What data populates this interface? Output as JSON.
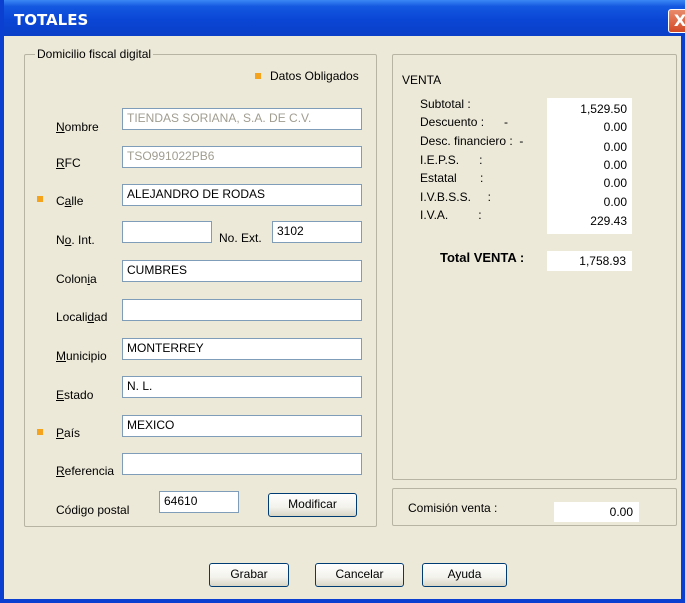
{
  "window": {
    "title": "TOTALES",
    "close_glyph": "X"
  },
  "fiscal": {
    "legend": "Domicilio fiscal digital",
    "required_note": "Datos Obligados",
    "nombre": {
      "label_pre": "",
      "label_u": "N",
      "label_post": "ombre",
      "value": "TIENDAS SORIANA, S.A. DE C.V."
    },
    "rfc": {
      "label_u": "R",
      "label_post": "FC",
      "value": "TSO991022PB6"
    },
    "calle": {
      "label_pre": "C",
      "label_u": "a",
      "label_post": "lle",
      "value": "ALEJANDRO DE RODAS"
    },
    "no_int": {
      "label_pre": "N",
      "label_u": "o",
      "label_post": ". Int.",
      "value": ""
    },
    "no_ext": {
      "label": "No. Ext.",
      "value": "3102"
    },
    "colonia": {
      "label_pre": "Colon",
      "label_u": "i",
      "label_post": "a",
      "value": "CUMBRES"
    },
    "localidad": {
      "label_pre": "Locali",
      "label_u": "d",
      "label_post": "ad",
      "value": ""
    },
    "municipio": {
      "label_u": "M",
      "label_post": "unicipio",
      "value": "MONTERREY"
    },
    "estado": {
      "label_u": "E",
      "label_post": "stado",
      "value": "N. L."
    },
    "pais": {
      "label_u": "P",
      "label_post": "aís",
      "value": "MEXICO"
    },
    "referencia": {
      "label_u": "R",
      "label_post": "eferencia",
      "value": ""
    },
    "codigo_postal": {
      "label": "Código postal",
      "value": "64610"
    },
    "modificar_label": "Modificar"
  },
  "venta": {
    "heading": "VENTA",
    "rows": [
      {
        "label": "Subtotal :",
        "value": "1,529.50"
      },
      {
        "label": "Descuento :      -",
        "value": "0.00"
      },
      {
        "label": "Desc. financiero :  -",
        "value": "0.00"
      },
      {
        "label": "I.E.P.S.      :",
        "value": "0.00"
      },
      {
        "label": "Estatal       :",
        "value": "0.00"
      },
      {
        "label": "I.V.B.S.S.     :",
        "value": "0.00"
      },
      {
        "label": "I.V.A.         :",
        "value": "229.43"
      }
    ],
    "total_label": "Total VENTA :",
    "total_value": "1,758.93"
  },
  "comision": {
    "label": "Comisión venta :",
    "value": "0.00"
  },
  "buttons": {
    "grabar": "Grabar",
    "cancelar": "Cancelar",
    "ayuda": "Ayuda"
  },
  "colors": {
    "title_bar": "#0a46d4",
    "required_marker": "#f5a31c",
    "face": "#ece9d8"
  }
}
